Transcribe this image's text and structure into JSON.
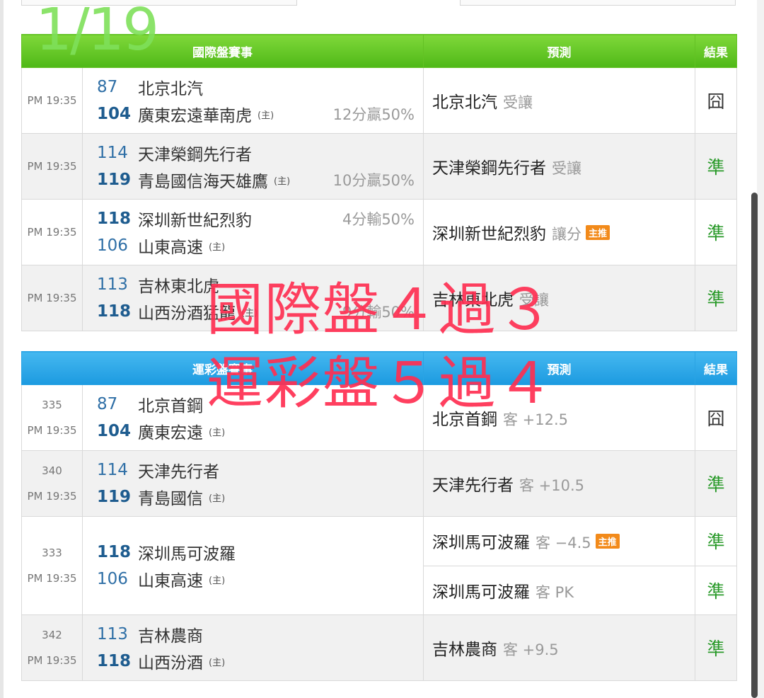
{
  "date_overlay": "1/19",
  "summary_overlay": {
    "line1": "國際盤４過３",
    "line2": "運彩盤５過４"
  },
  "home_marker": "(主)",
  "intl": {
    "headers": {
      "match": "國際盤賽事",
      "prediction": "預測",
      "result": "結果"
    },
    "rows": [
      {
        "time": "PM 19:35",
        "t1": {
          "score": "87",
          "name": "北京北汽",
          "home": ""
        },
        "t1_hc": "",
        "t2": {
          "score": "104",
          "name": "廣東宏遠華南虎",
          "home": "(主)"
        },
        "t2_hc": "12分贏50%",
        "pred": "北京北汽",
        "pred_note": "受讓",
        "badge": "",
        "result": "囧"
      },
      {
        "time": "PM 19:35",
        "t1": {
          "score": "114",
          "name": "天津榮鋼先行者",
          "home": ""
        },
        "t1_hc": "",
        "t2": {
          "score": "119",
          "name": "青島國信海天雄鷹",
          "home": "(主)"
        },
        "t2_hc": "10分贏50%",
        "pred": "天津榮鋼先行者",
        "pred_note": "受讓",
        "badge": "",
        "result": "準"
      },
      {
        "time": "PM 19:35",
        "t1": {
          "score": "118",
          "name": "深圳新世紀烈豹",
          "home": ""
        },
        "t1_hc": "4分輸50%",
        "t2": {
          "score": "106",
          "name": "山東高速",
          "home": "(主)"
        },
        "t2_hc": "",
        "pred": "深圳新世紀烈豹",
        "pred_note": "讓分",
        "badge": "主推",
        "result": "準"
      },
      {
        "time": "PM 19:35",
        "t1": {
          "score": "113",
          "name": "吉林東北虎",
          "home": ""
        },
        "t1_hc": "",
        "t2": {
          "score": "118",
          "name": "山西汾酒猛龍",
          "home": "(主)"
        },
        "t2_hc": "9分輸50%",
        "pred": "吉林東北虎",
        "pred_note": "受讓",
        "badge": "",
        "result": "準"
      }
    ]
  },
  "sport": {
    "headers": {
      "match": "運彩盤賽事",
      "prediction": "預測",
      "result": "結果"
    },
    "rows": [
      {
        "num": "335",
        "time": "PM 19:35",
        "t1": {
          "score": "87",
          "name": "北京首鋼",
          "home": ""
        },
        "t2": {
          "score": "104",
          "name": "廣東宏遠",
          "home": "(主)"
        },
        "preds": [
          {
            "team": "北京首鋼",
            "note": "客 +12.5",
            "badge": "",
            "result": "囧"
          }
        ]
      },
      {
        "num": "340",
        "time": "PM 19:35",
        "t1": {
          "score": "114",
          "name": "天津先行者",
          "home": ""
        },
        "t2": {
          "score": "119",
          "name": "青島國信",
          "home": "(主)"
        },
        "preds": [
          {
            "team": "天津先行者",
            "note": "客 +10.5",
            "badge": "",
            "result": "準"
          }
        ]
      },
      {
        "num": "333",
        "time": "PM 19:35",
        "t1": {
          "score": "118",
          "name": "深圳馬可波羅",
          "home": ""
        },
        "t2": {
          "score": "106",
          "name": "山東高速",
          "home": "(主)"
        },
        "preds": [
          {
            "team": "深圳馬可波羅",
            "note": "客 −4.5",
            "badge": "主推",
            "result": "準"
          },
          {
            "team": "深圳馬可波羅",
            "note": "客 PK",
            "badge": "",
            "result": "準"
          }
        ]
      },
      {
        "num": "342",
        "time": "PM 19:35",
        "t1": {
          "score": "113",
          "name": "吉林農商",
          "home": ""
        },
        "t2": {
          "score": "118",
          "name": "山西汾酒",
          "home": "(主)"
        },
        "preds": [
          {
            "team": "吉林農商",
            "note": "客 +9.5",
            "badge": "",
            "result": "準"
          }
        ]
      }
    ]
  }
}
